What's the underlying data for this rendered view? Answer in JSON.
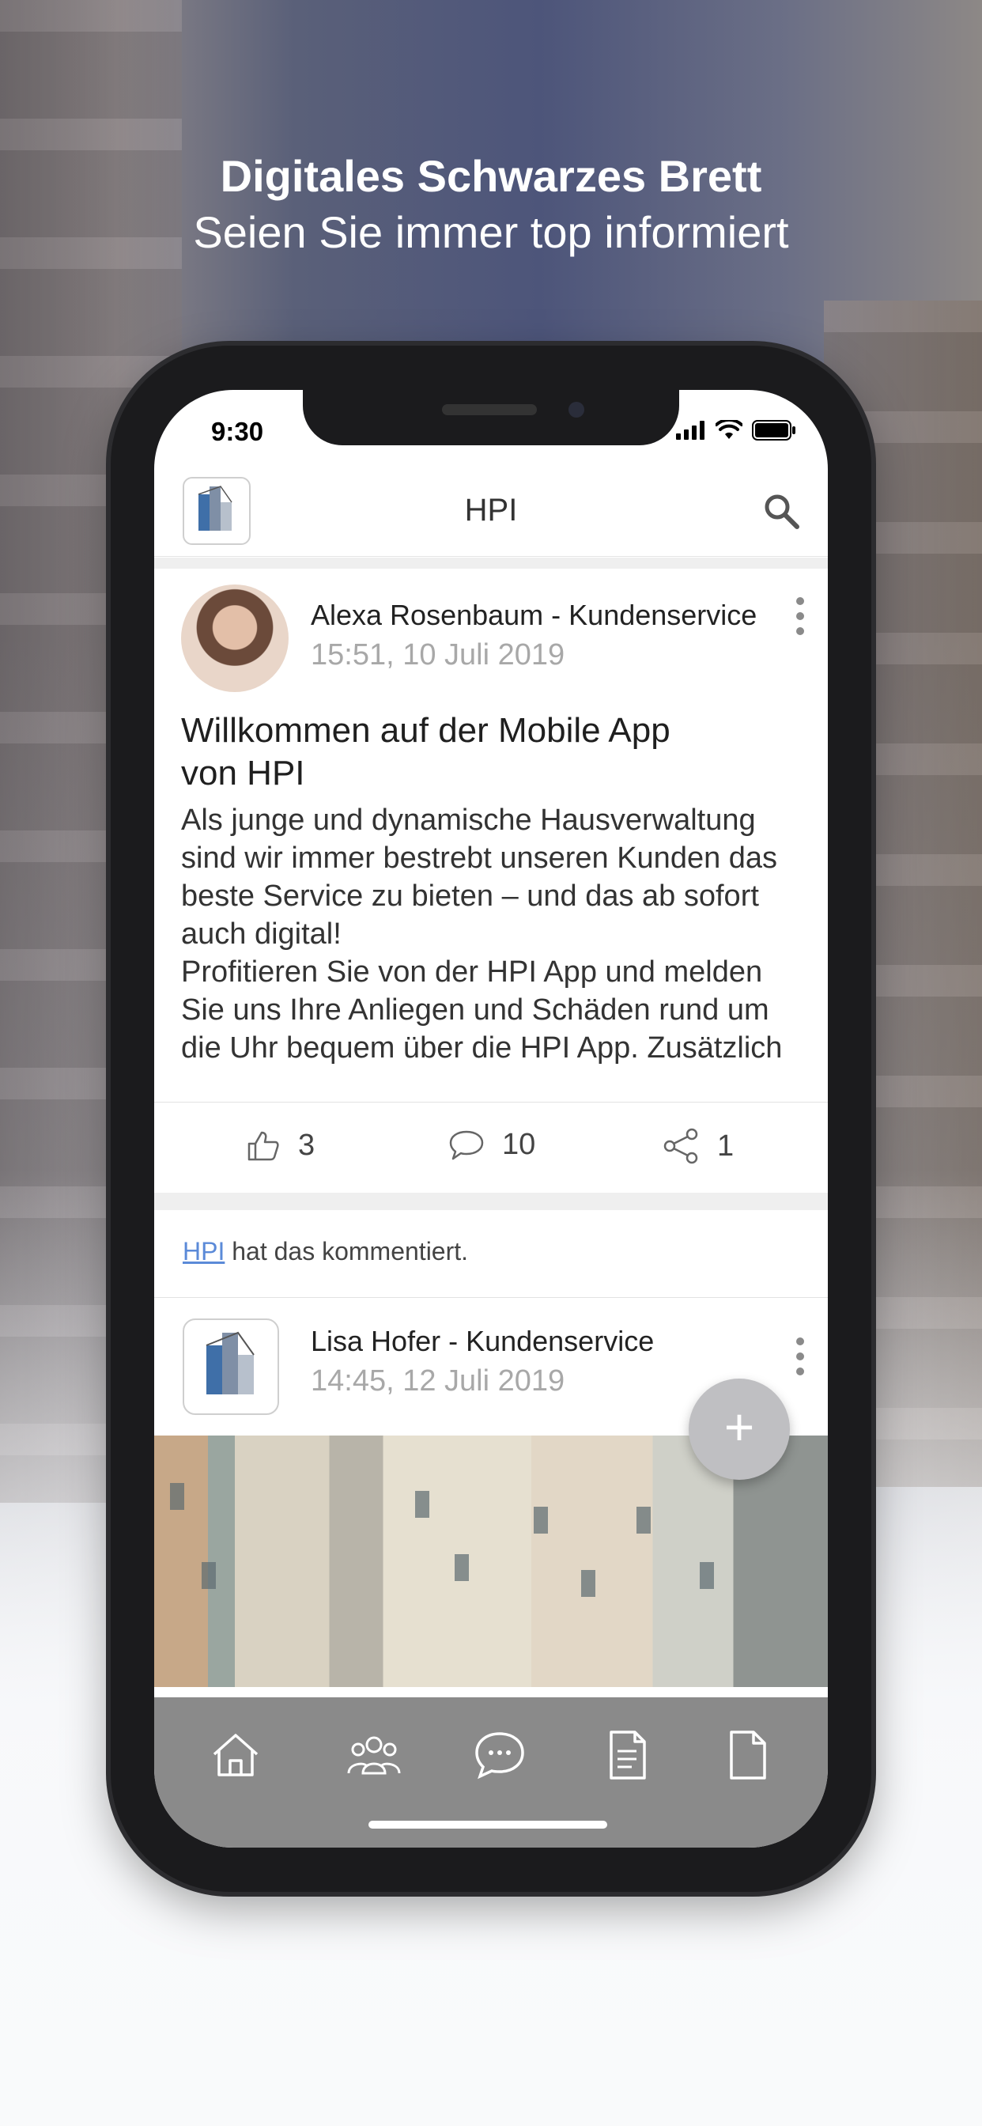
{
  "hero": {
    "title": "Digitales Schwarzes Brett",
    "subtitle": "Seien Sie immer top informiert"
  },
  "status": {
    "time": "9:30",
    "icons": [
      "signal-icon",
      "wifi-icon",
      "battery-icon"
    ]
  },
  "appbar": {
    "title": "HPI",
    "logo": "hpi-logo-icon",
    "search_icon": "search-icon"
  },
  "posts": [
    {
      "author": "Alexa Rosenbaum - Kundenservice",
      "date": "15:51, 10 Juli 2019",
      "title": "Willkommen auf der Mobile App von HPI",
      "body": [
        "Als junge und dynamische Hausverwaltung",
        "sind wir immer bestrebt unseren Kunden das",
        "beste Service zu bieten – und das ab sofort",
        "auch digital!",
        "Profitieren Sie von der HPI App und melden",
        "Sie uns Ihre Anliegen und Schäden rund um",
        "die Uhr bequem über die HPI App. Zusätzlich"
      ],
      "likes": "3",
      "comments": "10",
      "shares": "1"
    },
    {
      "author": "Lisa Hofer - Kundenservice",
      "date": "14:45, 12 Juli 2019"
    }
  ],
  "notice": {
    "link": "HPI",
    "text": " hat das kommentiert."
  },
  "fab": {
    "label": "+"
  },
  "tabbar": {
    "items": [
      "home-icon",
      "community-icon",
      "chat-icon",
      "document-list-icon",
      "file-icon"
    ]
  },
  "colors": {
    "tabbar_bg": "#8a8a8a",
    "link": "#5b8ad8",
    "fab": "#bfbfc2"
  }
}
